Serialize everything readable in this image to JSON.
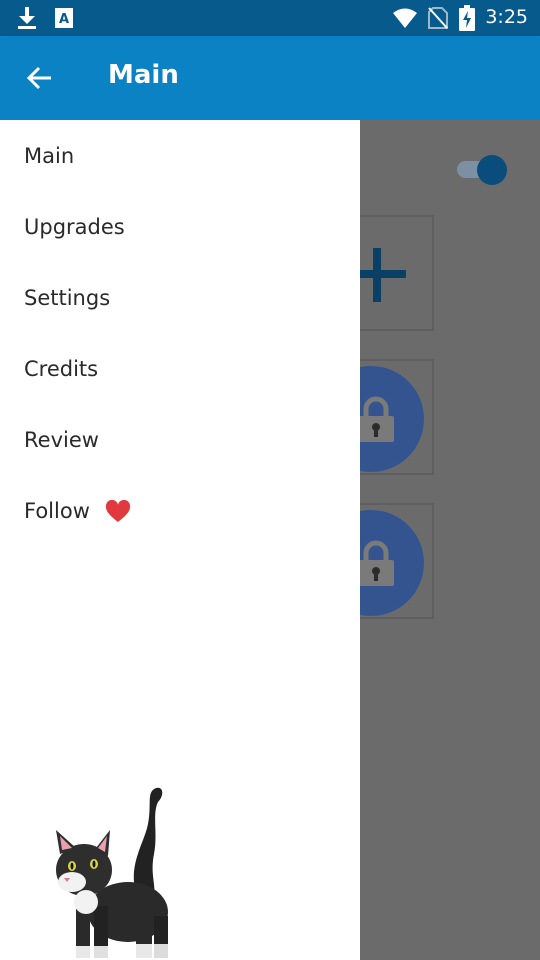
{
  "status_bar": {
    "time": "3:25",
    "icons": [
      "download-icon",
      "text-a-icon",
      "wifi-icon",
      "no-sim-icon",
      "battery-charging-icon"
    ]
  },
  "app_bar": {
    "title": "Main",
    "back_icon": "arrow-left-icon"
  },
  "drawer": {
    "items": [
      {
        "label": "Main"
      },
      {
        "label": "Upgrades"
      },
      {
        "label": "Settings"
      },
      {
        "label": "Credits"
      },
      {
        "label": "Review"
      },
      {
        "label": "Follow",
        "icon": "heart-icon",
        "icon_glyph": "❤️"
      }
    ]
  },
  "background_screen": {
    "toggle_state": "on",
    "tiles": [
      "plus-icon",
      "lock-icon",
      "lock-icon"
    ]
  },
  "colors": {
    "status_bar": "#075a8c",
    "app_bar": "#0a82c4",
    "drawer": "#ffffff",
    "scrim": "#6b6b6b",
    "heart": "#e0393e"
  }
}
